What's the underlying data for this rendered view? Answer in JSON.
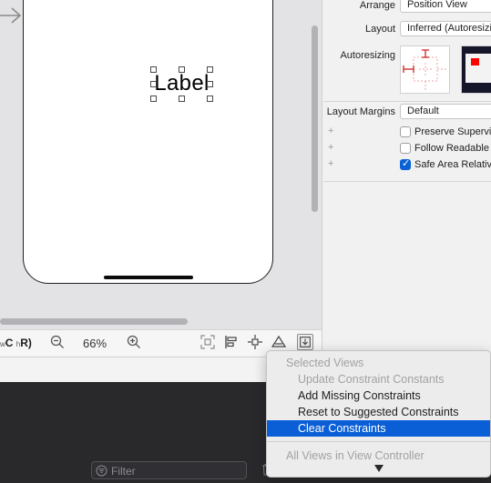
{
  "canvas": {
    "label_text": "Label"
  },
  "bottom_bar": {
    "size_class_w": "w",
    "size_class_c": "C",
    "size_class_h": "h",
    "size_class_r": "R)",
    "zoom_level": "66%"
  },
  "inspector": {
    "arrange_label": "Arrange",
    "arrange_value": "Position View",
    "layout_label": "Layout",
    "layout_value": "Inferred (Autoresizing Mask)",
    "autoresizing_label": "Autoresizing",
    "margins_label": "Layout Margins",
    "margins_value": "Default",
    "checkboxes": [
      {
        "label": "Preserve Superview Margins",
        "checked": false
      },
      {
        "label": "Follow Readable Width",
        "checked": false
      },
      {
        "label": "Safe Area Relative Margins",
        "checked": true
      }
    ],
    "plus_glyph": "+"
  },
  "console": {
    "filter_placeholder": "Filter"
  },
  "menu": {
    "items": [
      {
        "label": "Selected Views",
        "kind": "header"
      },
      {
        "label": "Update Constraint Constants",
        "kind": "disabled"
      },
      {
        "label": "Add Missing Constraints",
        "kind": "enabled"
      },
      {
        "label": "Reset to Suggested Constraints",
        "kind": "enabled"
      },
      {
        "label": "Clear Constraints",
        "kind": "selected"
      },
      {
        "label": "All Views in View Controller",
        "kind": "header"
      }
    ]
  },
  "colors": {
    "accent": "#0a5fd6",
    "checkbox_checked": "#0a62d4",
    "canvas_bg": "#e3e3e6",
    "console_bg": "#29292c",
    "autoresize_red": "#ff0000"
  },
  "icons": {
    "entry": "arrow-right-icon",
    "zoom_out": "zoom-out-icon",
    "zoom_in": "zoom-in-icon",
    "update_frames": "update-frames-icon",
    "align": "align-icon",
    "add_constraints": "add-constraints-icon",
    "resolve": "resolve-auto-layout-icon",
    "embed": "embed-in-icon",
    "filter": "filter-icon",
    "trash": "trash-icon",
    "menu_scroll": "scroll-down-arrow-icon"
  }
}
